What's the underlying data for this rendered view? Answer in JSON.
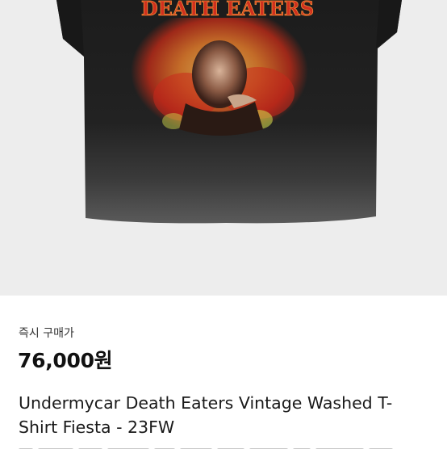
{
  "product": {
    "image_alt": "Undermycar Death Eaters Vintage Washed T-Shirt",
    "print_text": "DEATH EATERS",
    "price_label": "즉시 구매가",
    "price": "76,000원",
    "title": "Undermycar Death Eaters Vintage Washed T-Shirt Fiesta - 23FW"
  },
  "colors": {
    "shirt": "#1e1e1e",
    "background": "#ededed",
    "print_red": "#c8281c",
    "print_orange": "#e98a2c"
  }
}
